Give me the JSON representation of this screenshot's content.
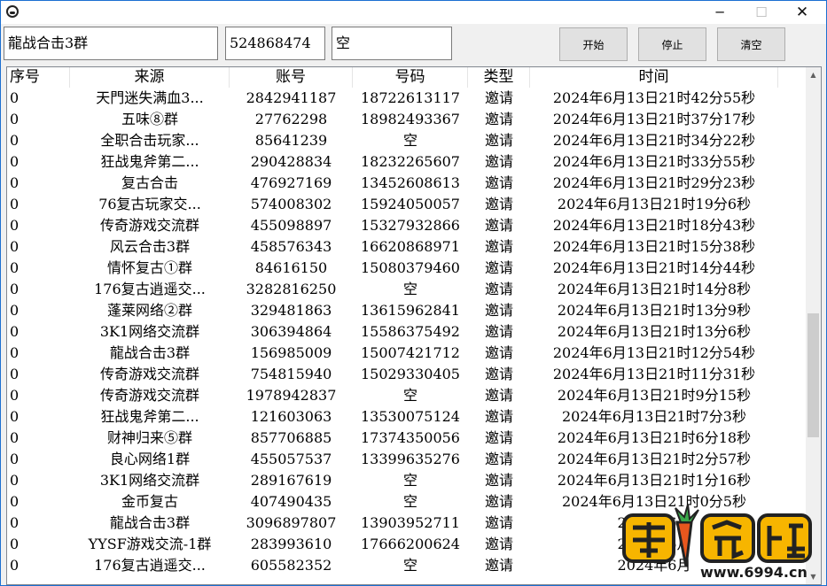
{
  "window": {
    "icon": "app-icon",
    "controls": {
      "minimize": "─",
      "maximize": "☐",
      "close": "✕"
    }
  },
  "toolbar": {
    "source_input": "龍战合击3群",
    "account_input": "524868474",
    "phone_input": "空",
    "start_label": "开始",
    "stop_label": "停止",
    "clear_label": "清空"
  },
  "table": {
    "columns": [
      "序号",
      "来源",
      "账号",
      "号码",
      "类型",
      "时间"
    ],
    "rows": [
      [
        "0",
        "天門迷失满血3...",
        "2842941187",
        "18722613117",
        "邀请",
        "2024年6月13日21时42分55秒"
      ],
      [
        "0",
        "五味⑧群",
        "27762298",
        "18982493367",
        "邀请",
        "2024年6月13日21时37分17秒"
      ],
      [
        "0",
        "全职合击玩家...",
        "85641239",
        "空",
        "邀请",
        "2024年6月13日21时34分22秒"
      ],
      [
        "0",
        "狂战鬼斧第二...",
        "290428834",
        "18232265607",
        "邀请",
        "2024年6月13日21时33分55秒"
      ],
      [
        "0",
        "复古合击",
        "476927169",
        "13452608613",
        "邀请",
        "2024年6月13日21时29分23秒"
      ],
      [
        "0",
        "76复古玩家交...",
        "574008302",
        "15924050057",
        "邀请",
        "2024年6月13日21时19分6秒"
      ],
      [
        "0",
        "传奇游戏交流群",
        "455098897",
        "15327932866",
        "邀请",
        "2024年6月13日21时18分43秒"
      ],
      [
        "0",
        "风云合击3群",
        "458576343",
        "16620868971",
        "邀请",
        "2024年6月13日21时15分38秒"
      ],
      [
        "0",
        "情怀复古①群",
        "84616150",
        "15080379460",
        "邀请",
        "2024年6月13日21时14分44秒"
      ],
      [
        "0",
        "176复古逍遥交...",
        "3282816250",
        "空",
        "邀请",
        "2024年6月13日21时14分8秒"
      ],
      [
        "0",
        "蓬莱网络②群",
        "329481863",
        "13615962841",
        "邀请",
        "2024年6月13日21时13分9秒"
      ],
      [
        "0",
        "3K1网络交流群",
        "306394864",
        "15586375492",
        "邀请",
        "2024年6月13日21时13分6秒"
      ],
      [
        "0",
        "龍战合击3群",
        "156985009",
        "15007421712",
        "邀请",
        "2024年6月13日21时12分54秒"
      ],
      [
        "0",
        "传奇游戏交流群",
        "754815940",
        "15029330405",
        "邀请",
        "2024年6月13日21时11分31秒"
      ],
      [
        "0",
        "传奇游戏交流群",
        "1978942837",
        "空",
        "邀请",
        "2024年6月13日21时9分15秒"
      ],
      [
        "0",
        "狂战鬼斧第二...",
        "121603063",
        "13530075124",
        "邀请",
        "2024年6月13日21时7分3秒"
      ],
      [
        "0",
        "财神归来⑤群",
        "857706885",
        "17374350056",
        "邀请",
        "2024年6月13日21时6分18秒"
      ],
      [
        "0",
        "良心网络1群",
        "455057537",
        "13399635276",
        "邀请",
        "2024年6月13日21时2分57秒"
      ],
      [
        "0",
        "3K1网络交流群",
        "289167619",
        "空",
        "邀请",
        "2024年6月13日21时1分16秒"
      ],
      [
        "0",
        "金币复古",
        "407490435",
        "空",
        "邀请",
        "2024年6月13日21时0分5秒"
      ],
      [
        "0",
        "龍战合击3群",
        "3096897807",
        "13903952711",
        "邀请",
        "2024年6月"
      ],
      [
        "0",
        "YYSF游戏交流-1群",
        "283993610",
        "17666200624",
        "邀请",
        "2024年6月"
      ],
      [
        "0",
        "176复古逍遥交...",
        "605582352",
        "空",
        "邀请",
        "2024年6月"
      ]
    ]
  },
  "watermark": {
    "text": "萝卜论坛",
    "url": "www.6994.cn",
    "colors": {
      "fill": "#f7b500",
      "outline": "#222222",
      "accent": "#e8571e"
    }
  },
  "colors": {
    "window_border": "#1c6fd1",
    "button_bg": "#e1e1e1",
    "scroll_thumb": "#cdcdcd"
  }
}
